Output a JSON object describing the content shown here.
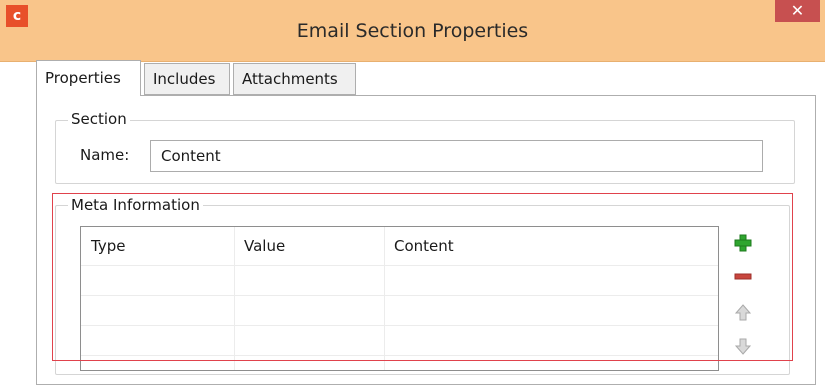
{
  "window": {
    "title": "Email Section Properties",
    "app_icon_letter": "c",
    "close_glyph": "✕"
  },
  "tabs": [
    {
      "label": "Properties",
      "active": true
    },
    {
      "label": "Includes",
      "active": false
    },
    {
      "label": "Attachments",
      "active": false
    }
  ],
  "section": {
    "legend": "Section",
    "name_label": "Name:",
    "name_value": "Content"
  },
  "meta": {
    "legend": "Meta Information",
    "columns": [
      "Type",
      "Value",
      "Content"
    ],
    "rows": [
      [
        "",
        "",
        ""
      ],
      [
        "",
        "",
        ""
      ],
      [
        "",
        "",
        ""
      ]
    ]
  },
  "side_buttons": [
    {
      "icon": "add-icon",
      "color": "#2fa52f",
      "enabled": true
    },
    {
      "icon": "remove-icon",
      "color": "#c8463e",
      "enabled": true
    },
    {
      "icon": "move-up-icon",
      "color": "#b9b9b9",
      "enabled": false
    },
    {
      "icon": "move-down-icon",
      "color": "#b9b9b9",
      "enabled": false
    }
  ],
  "colors": {
    "titlebar": "#f9c58a",
    "app_icon": "#e8502a",
    "close_button": "#c75050",
    "highlight_border": "#e0424c"
  }
}
